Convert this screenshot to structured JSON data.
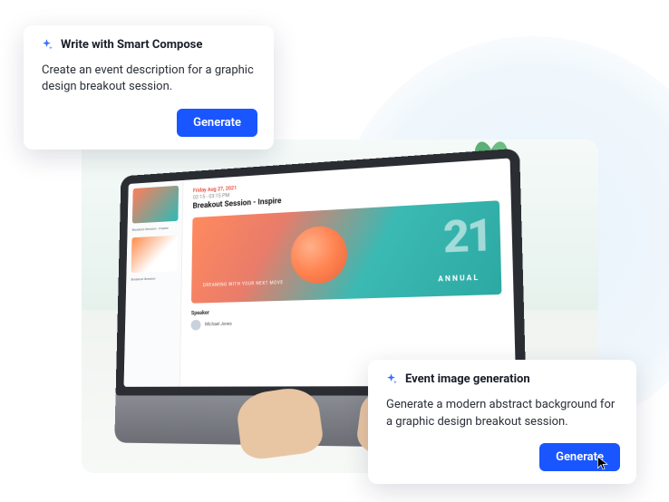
{
  "card1": {
    "title": "Write with Smart Compose",
    "body": "Create an event description for a graphic design breakout session.",
    "cta": "Generate"
  },
  "card2": {
    "title": "Event image generation",
    "body": "Generate a modern abstract background for a graphic design breakout session.",
    "cta": "Generate"
  },
  "laptop_screen": {
    "date": "Friday Aug 27, 2021",
    "time": "02:15 - 03:15 PM",
    "title": "Breakout Session - Inspire",
    "hero_tagline": "DREAMING WITH YOUR NEXT MOVE",
    "hero_number": "21",
    "hero_label": "ANNUAL",
    "speaker_heading": "Speaker",
    "speaker_name": "Michael Jones",
    "thumbs": [
      {
        "caption": "Breakout Session - Inspire"
      },
      {
        "caption": "Breakout Session"
      }
    ]
  },
  "colors": {
    "accent": "#1a56ff"
  }
}
